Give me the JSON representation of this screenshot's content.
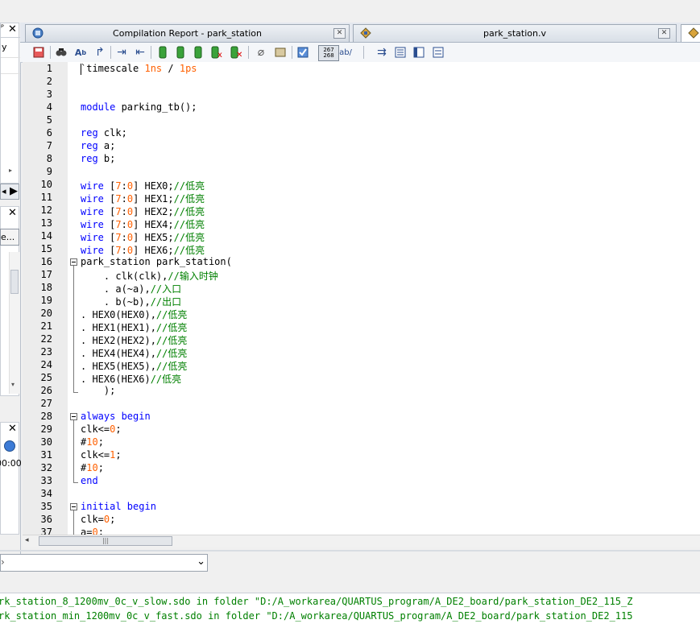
{
  "tabs": [
    {
      "label": "Compilation Report - park_station",
      "icon": "report-icon",
      "active": false
    },
    {
      "label": "park_station.v",
      "icon": "verilog-file-icon",
      "active": true
    }
  ],
  "toolbar_icons": [
    "save-icon",
    "find-icon",
    "find-replace-icon",
    "goto-line-icon",
    "indent-icon",
    "unindent-icon",
    "bookmark-toggle-icon",
    "bookmark-prev-icon",
    "bookmark-next-icon",
    "bookmark-clear-icon",
    "bookmark-delete-icon",
    "attach-icon",
    "template-icon",
    "insert-icon",
    "line-numbers-icon",
    "spell-icon",
    "wrap-icon",
    "print-icon",
    "properties-icon",
    "list-icon"
  ],
  "left_panel": {
    "panel1_header_glyph": "ᴾ",
    "panel1_text": "y",
    "panel2_button": "e...",
    "panel3_time": "00:00"
  },
  "code_lines": [
    {
      "n": "1",
      "html": "`timescale <span class=\"num\">1ns</span> / <span class=\"num\">1ps</span>"
    },
    {
      "n": "2",
      "html": ""
    },
    {
      "n": "3",
      "html": ""
    },
    {
      "n": "4",
      "html": "<span class=\"kw\">module</span> parking_tb();"
    },
    {
      "n": "5",
      "html": ""
    },
    {
      "n": "6",
      "html": "<span class=\"kw\">reg</span> clk;"
    },
    {
      "n": "7",
      "html": "<span class=\"kw\">reg</span> a;"
    },
    {
      "n": "8",
      "html": "<span class=\"kw\">reg</span> b;"
    },
    {
      "n": "9",
      "html": ""
    },
    {
      "n": "10",
      "html": "<span class=\"kw\">wire</span> [<span class=\"num\">7</span>:<span class=\"num\">0</span>] HEX0;<span class=\"cm\">//低亮</span>"
    },
    {
      "n": "11",
      "html": "<span class=\"kw\">wire</span> [<span class=\"num\">7</span>:<span class=\"num\">0</span>] HEX1;<span class=\"cm\">//低亮</span>"
    },
    {
      "n": "12",
      "html": "<span class=\"kw\">wire</span> [<span class=\"num\">7</span>:<span class=\"num\">0</span>] HEX2;<span class=\"cm\">//低亮</span>"
    },
    {
      "n": "13",
      "html": "<span class=\"kw\">wire</span> [<span class=\"num\">7</span>:<span class=\"num\">0</span>] HEX4;<span class=\"cm\">//低亮</span>"
    },
    {
      "n": "14",
      "html": "<span class=\"kw\">wire</span> [<span class=\"num\">7</span>:<span class=\"num\">0</span>] HEX5;<span class=\"cm\">//低亮</span>"
    },
    {
      "n": "15",
      "html": "<span class=\"kw\">wire</span> [<span class=\"num\">7</span>:<span class=\"num\">0</span>] HEX6;<span class=\"cm\">//低亮</span>"
    },
    {
      "n": "16",
      "html": "park_station park_station("
    },
    {
      "n": "17",
      "html": "    . clk(clk),<span class=\"cm\">//输入时钟</span>"
    },
    {
      "n": "18",
      "html": "    . a(~a),<span class=\"cm\">//入口</span>"
    },
    {
      "n": "19",
      "html": "    . b(~b),<span class=\"cm\">//出口</span>"
    },
    {
      "n": "20",
      "html": ". HEX0(HEX0),<span class=\"cm\">//低亮</span>"
    },
    {
      "n": "21",
      "html": ". HEX1(HEX1),<span class=\"cm\">//低亮</span>"
    },
    {
      "n": "22",
      "html": ". HEX2(HEX2),<span class=\"cm\">//低亮</span>"
    },
    {
      "n": "23",
      "html": ". HEX4(HEX4),<span class=\"cm\">//低亮</span>"
    },
    {
      "n": "24",
      "html": ". HEX5(HEX5),<span class=\"cm\">//低亮</span>"
    },
    {
      "n": "25",
      "html": ". HEX6(HEX6)<span class=\"cm\">//低亮</span>"
    },
    {
      "n": "26",
      "html": "    );"
    },
    {
      "n": "27",
      "html": ""
    },
    {
      "n": "28",
      "html": "<span class=\"kw\">always begin</span>"
    },
    {
      "n": "29",
      "html": "clk&lt;=<span class=\"num\">0</span>;"
    },
    {
      "n": "30",
      "html": "#<span class=\"num\">10</span>;"
    },
    {
      "n": "31",
      "html": "clk&lt;=<span class=\"num\">1</span>;"
    },
    {
      "n": "32",
      "html": "#<span class=\"num\">10</span>;"
    },
    {
      "n": "33",
      "html": "<span class=\"kw\">end</span>"
    },
    {
      "n": "34",
      "html": ""
    },
    {
      "n": "35",
      "html": "<span class=\"kw\">initial begin</span>"
    },
    {
      "n": "36",
      "html": "clk=<span class=\"num\">0</span>;"
    },
    {
      "n": "37",
      "html": "a=<span class=\"num\">0</span>;"
    }
  ],
  "messages": [
    "rk_station_8_1200mv_0c_v_slow.sdo in folder \"D:/A_workarea/QUARTUS_program/A_DE2_board/park_station_DE2_115_Z",
    "rk_station_min_1200mv_0c_v_fast.sdo in folder \"D:/A_workarea/QUARTUS_program/A_DE2_board/park_station_DE2_115"
  ],
  "colors": {
    "keyword": "#0000ff",
    "number": "#ff6000",
    "comment": "#008000",
    "message": "#008000"
  }
}
